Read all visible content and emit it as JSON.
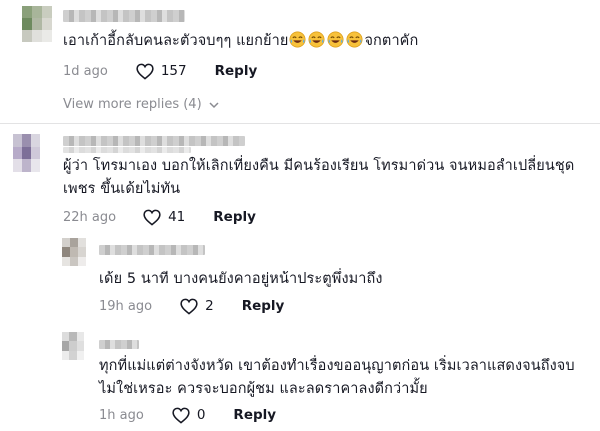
{
  "comments": [
    {
      "text_before_emoji": "เอาเก้าอี้กลับคนละตัวจบๆๆ แยกย้าย",
      "emoji_name": "tears-of-joy-emoji",
      "emoji_count": 4,
      "text_after_emoji": "จกตาคัก",
      "time": "1d ago",
      "likes": "157",
      "reply_label": "Reply",
      "view_more": "View more replies (4)"
    },
    {
      "text_line1": "ผู้ว่า โทรมาเอง บอกให้เลิกเที่ยงคืน มีคนร้องเรียน โทรมาด่วน จนหมอลำเปลี่ยนชุด",
      "text_line2": "เพชร ขึ้นเด้ยไม่ทัน",
      "time": "22h ago",
      "likes": "41",
      "reply_label": "Reply",
      "replies": [
        {
          "text": "เด้ย 5 นาที บางคนยังคาอยู่หน้าประตูพึ่งมาถึง",
          "time": "19h ago",
          "likes": "2",
          "reply_label": "Reply"
        },
        {
          "text_line1": "ทุกที่แม่แต่ต่างจังหวัด เขาต้องทำเรื่องขออนุญาตก่อน เริ่มเวลาแสดงจนถึงจบ",
          "text_line2": "ไม่ใช่เหรอะ ควรจะบอกผู้ชม และลดราคาลงดีกว่ามั้ย",
          "time": "1h ago",
          "likes": "0",
          "reply_label": "Reply"
        }
      ]
    }
  ],
  "icons": {
    "like": "heart-outline-icon",
    "view_more": "chevron-down-icon"
  },
  "colors": {
    "text": "#161823",
    "secondary": "#8a8b91",
    "divider": "#e3e3e4"
  }
}
